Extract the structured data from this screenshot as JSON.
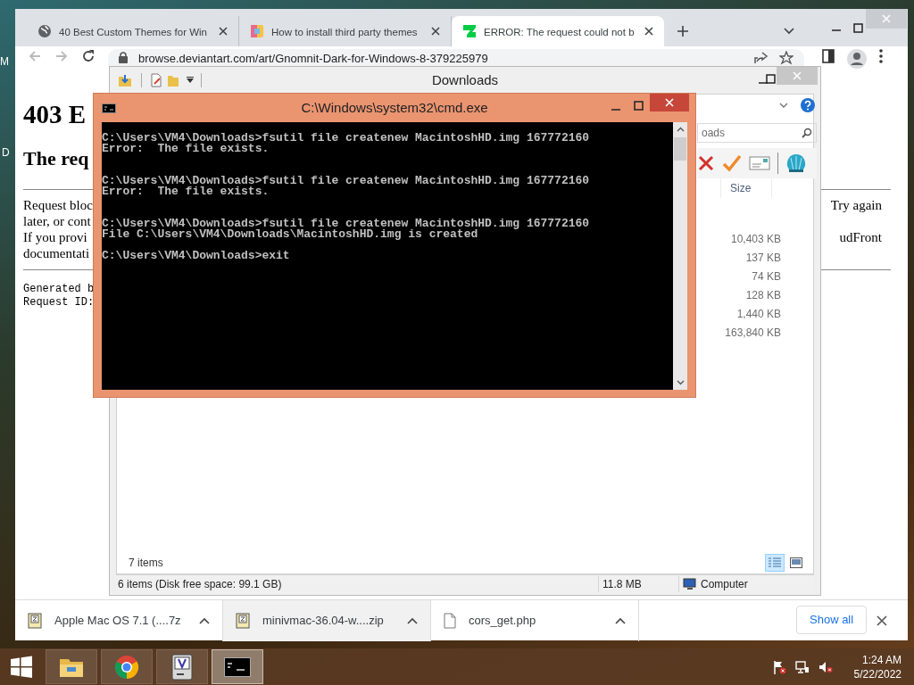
{
  "desktop": {
    "icon_labels": [
      "M",
      "D"
    ]
  },
  "browser": {
    "tabs": [
      {
        "title": "40 Best Custom Themes for Win",
        "kind": "globe",
        "selected": false
      },
      {
        "title": "How to install third party themes",
        "kind": "sp",
        "selected": false
      },
      {
        "title": "ERROR: The request could not b",
        "kind": "deviant",
        "selected": true
      }
    ],
    "address": "browse.deviantart.com/art/Gnomnit-Dark-for-Windows-8-379225979",
    "page": {
      "heading": "403 E",
      "subheading": "The req",
      "lines": [
        {
          "left": "Request bloc",
          "right": "Try again"
        },
        {
          "left": "later, or cont"
        },
        {
          "left": "If you provi",
          "right": "udFront"
        },
        {
          "left": "documentati"
        }
      ],
      "footer_lines": [
        "Generated b",
        "Request ID:"
      ]
    },
    "downloads": [
      {
        "name": "Apple Mac OS 7.1 (....7z",
        "kind": "archive",
        "highlighted": false
      },
      {
        "name": "minivmac-36.04-w....zip",
        "kind": "archive",
        "highlighted": true
      },
      {
        "name": "cors_get.php",
        "kind": "file",
        "highlighted": false
      }
    ],
    "show_all": "Show all"
  },
  "explorer": {
    "title": "Downloads",
    "search_placeholder": "oads",
    "columns": [
      "Size"
    ],
    "sizes": [
      "10,403 KB",
      "137 KB",
      "74 KB",
      "128 KB",
      "1,440 KB",
      "163,840 KB"
    ],
    "item_count": "7 items",
    "views": [
      {
        "kind": "details",
        "selected": true
      },
      {
        "kind": "preview",
        "selected": false
      }
    ],
    "status": {
      "selection": "6 items (Disk free space: 99.1 GB)",
      "size": "11.8 MB",
      "location": "Computer"
    }
  },
  "cmd": {
    "title": "C:\\Windows\\system32\\cmd.exe",
    "lines": [
      {
        "kind": "command",
        "text": "C:\\Users\\VM4\\Downloads>fsutil file createnew MacintoshHD.img 167772160"
      },
      {
        "kind": "error",
        "text": "Error:  The file exists."
      },
      {
        "kind": "command",
        "text": "C:\\Users\\VM4\\Downloads>fsutil file createnew MacintoshHD.img 167772160"
      },
      {
        "kind": "error",
        "text": "Error:  The file exists."
      },
      {
        "kind": "command",
        "text": "C:\\Users\\VM4\\Downloads>fsutil file createnew MacintoshHD.img 167772160"
      },
      {
        "kind": "result",
        "text": "File C:\\Users\\VM4\\Downloads\\MacintoshHD.img is created"
      },
      {
        "kind": "prompt",
        "text": "C:\\Users\\VM4\\Downloads>exit"
      }
    ]
  },
  "taskbar": {
    "apps": [
      {
        "kind": "explorer",
        "active": false
      },
      {
        "kind": "chrome",
        "active": false
      },
      {
        "kind": "minivmac",
        "active": false
      },
      {
        "kind": "cmd",
        "active": true
      }
    ],
    "time": "1:24 AM",
    "date": "5/22/2022"
  }
}
